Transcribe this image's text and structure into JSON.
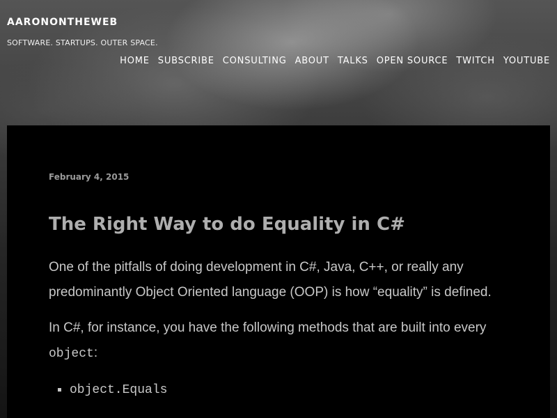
{
  "site": {
    "title": "AARONONTHEWEB",
    "tagline": "SOFTWARE. STARTUPS. OUTER SPACE."
  },
  "nav": {
    "items": [
      {
        "label": "HOME"
      },
      {
        "label": "SUBSCRIBE"
      },
      {
        "label": "CONSULTING"
      },
      {
        "label": "ABOUT"
      },
      {
        "label": "TALKS"
      },
      {
        "label": "OPEN SOURCE"
      },
      {
        "label": "TWITCH"
      },
      {
        "label": "YOUTUBE"
      }
    ]
  },
  "post": {
    "date": "February 4, 2015",
    "title": "The Right Way to do Equality in C#",
    "paragraph1": "One of the pitfalls of doing development in C#, Java, C++, or really any predominantly Object Oriented language (OOP) is how “equality” is defined.",
    "paragraph2_text": "In C#, for instance, you have the following methods that are built into every ",
    "paragraph2_code": "object",
    "paragraph2_end": ":",
    "list": [
      {
        "code": "object.Equals"
      }
    ]
  },
  "colors": {
    "content_background": "#000000",
    "title_color": "#aeaeae",
    "date_color": "#9a9a9a",
    "body_text": "#c8c8c8",
    "header_text": "#ffffff"
  }
}
